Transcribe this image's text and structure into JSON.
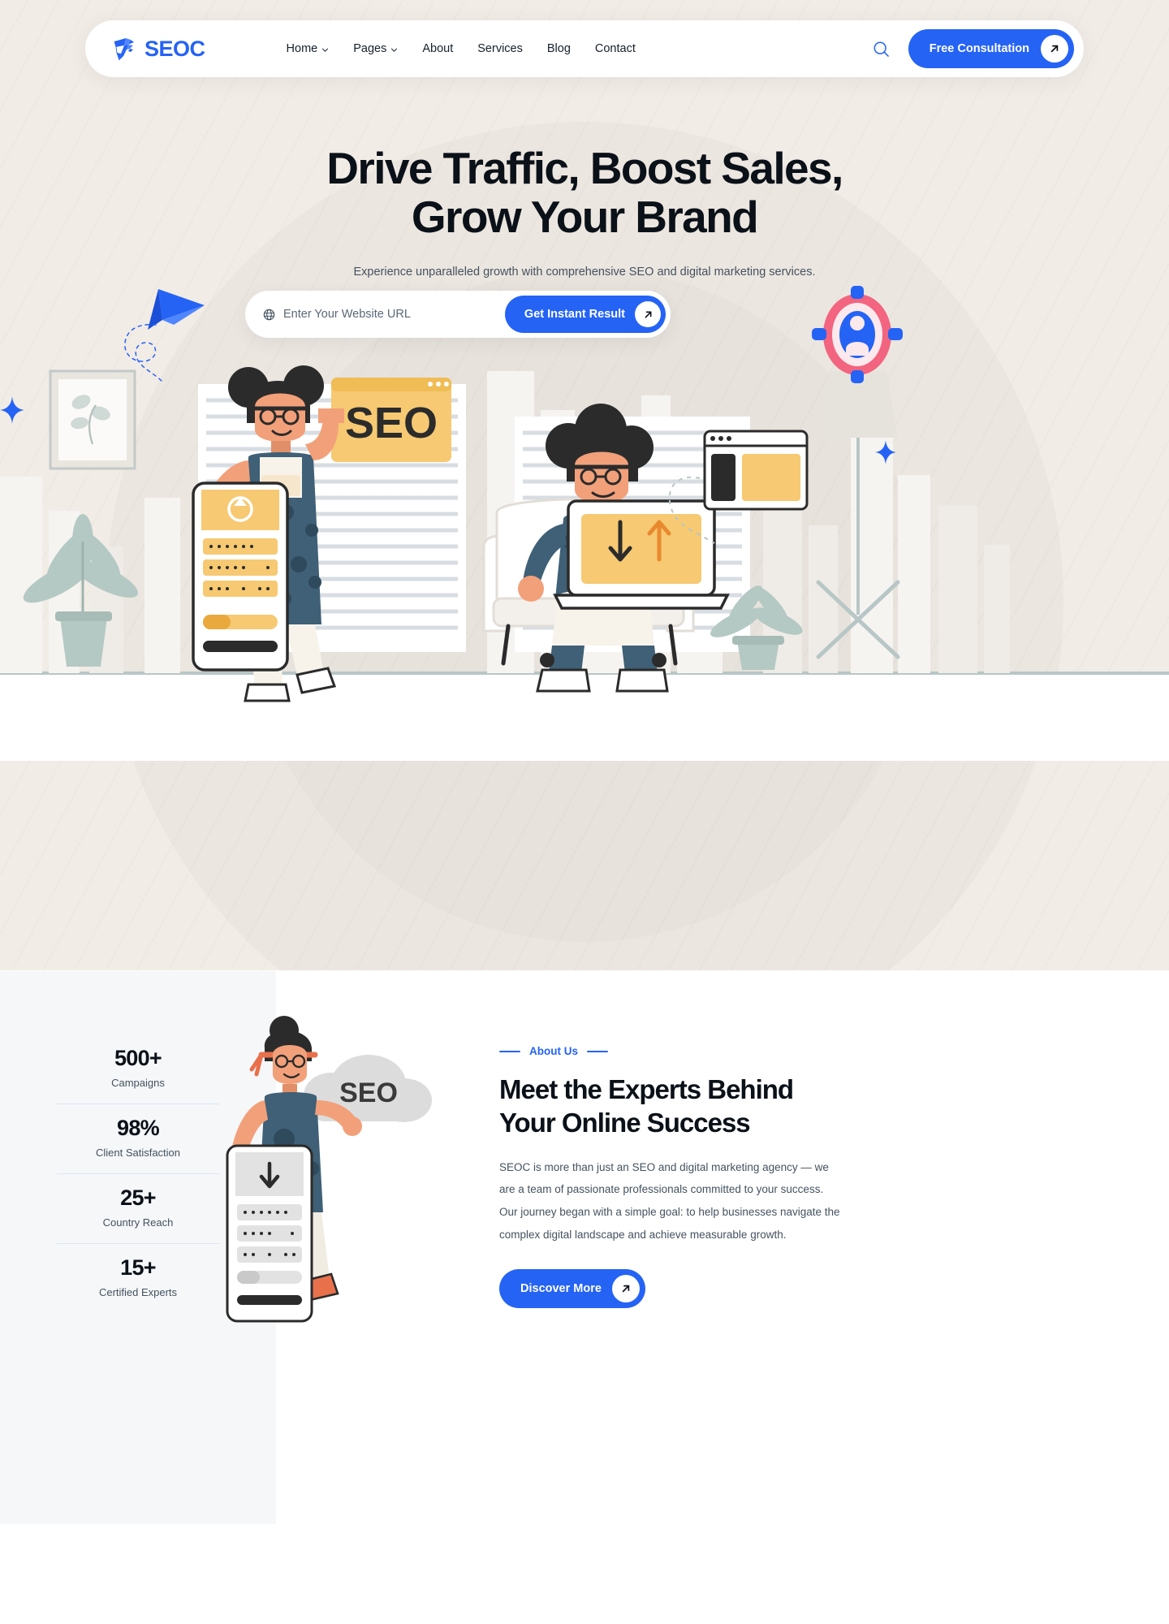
{
  "brand": {
    "name": "SEOC",
    "logo_icon": "seoc-origami-logo",
    "color": "#2563f5"
  },
  "nav": {
    "items": [
      {
        "label": "Home",
        "has_dropdown": true
      },
      {
        "label": "Pages",
        "has_dropdown": true
      },
      {
        "label": "About",
        "has_dropdown": false
      },
      {
        "label": "Services",
        "has_dropdown": false
      },
      {
        "label": "Blog",
        "has_dropdown": false
      },
      {
        "label": "Contact",
        "has_dropdown": false
      }
    ],
    "search_icon": "search-icon",
    "cta_label": "Free Consultation",
    "cta_icon": "arrow-up-right-icon"
  },
  "hero": {
    "title_line1": "Drive Traffic, Boost Sales,",
    "title_line2": "Grow Your Brand",
    "subtitle": "Experience unparalleled growth with comprehensive SEO and digital marketing services.",
    "url_field": {
      "value": "",
      "placeholder": "Enter Your Website URL",
      "icon": "globe-icon"
    },
    "submit_label": "Get Instant Result",
    "submit_icon": "arrow-up-right-icon",
    "background_color": "#f2ece6",
    "illustration_sign_text": "SEO",
    "decorations": [
      "paper-plane-icon",
      "lifebuoy-icon",
      "sparkle-icon",
      "sparkle-icon"
    ]
  },
  "about": {
    "stats": [
      {
        "value": "500+",
        "label": "Campaigns"
      },
      {
        "value": "98%",
        "label": "Client Satisfaction"
      },
      {
        "value": "25+",
        "label": "Country Reach"
      },
      {
        "value": "15+",
        "label": "Certified Experts"
      }
    ],
    "eyebrow": "About Us",
    "title_line1": "Meet the Experts Behind",
    "title_line2": "Your Online Success",
    "body": "SEOC is more than just an SEO and digital marketing agency — we are a team of passionate professionals committed to your success. Our journey began with a simple goal: to help businesses navigate the complex digital landscape and achieve measurable growth.",
    "button_label": "Discover More",
    "button_icon": "arrow-up-right-icon",
    "illustration_cloud_text": "SEO"
  }
}
